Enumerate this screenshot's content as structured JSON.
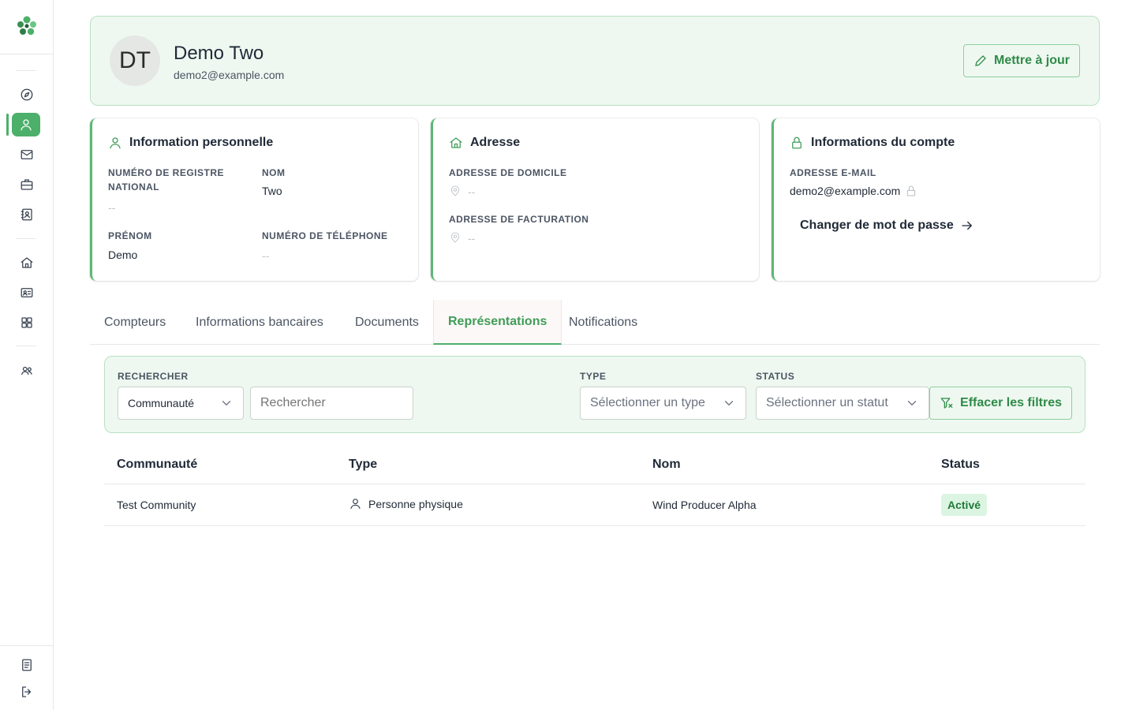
{
  "colors": {
    "accent": "#4caf6a",
    "accent_dark": "#2f8b48",
    "panel_bg": "#eef8f0",
    "badge_bg": "#dcf5e2"
  },
  "sidebar": {
    "icons": [
      "logo-icon",
      "compass-icon",
      "user-icon",
      "mail-icon",
      "briefcase-icon",
      "contacts-icon",
      "home-icon",
      "id-card-icon",
      "grid-icon",
      "users-icon",
      "document-icon",
      "logout-icon"
    ]
  },
  "profile": {
    "initials": "DT",
    "name": "Demo Two",
    "email": "demo2@example.com",
    "update_label": "Mettre à jour"
  },
  "personal": {
    "title": "Information personnelle",
    "registry_label": "NUMÉRO DE REGISTRE NATIONAL",
    "registry_value": "--",
    "lastname_label": "NOM",
    "lastname_value": "Two",
    "firstname_label": "PRÉNOM",
    "firstname_value": "Demo",
    "phone_label": "NUMÉRO DE TÉLÉPHONE",
    "phone_value": "--"
  },
  "address": {
    "title": "Adresse",
    "home_label": "ADRESSE DE DOMICILE",
    "home_value": "--",
    "billing_label": "ADRESSE DE FACTURATION",
    "billing_value": "--"
  },
  "account": {
    "title": "Informations du compte",
    "email_label": "ADRESSE E-MAIL",
    "email_value": "demo2@example.com",
    "password_link": "Changer de mot de passe"
  },
  "tabs": [
    {
      "label": "Compteurs",
      "active": false
    },
    {
      "label": "Informations bancaires",
      "active": false
    },
    {
      "label": "Documents",
      "active": false
    },
    {
      "label": "Représentations",
      "active": true
    },
    {
      "label": "Notifications",
      "active": false
    }
  ],
  "filters": {
    "search_label": "RECHERCHER",
    "search_scope": "Communauté",
    "search_placeholder": "Rechercher",
    "type_label": "TYPE",
    "type_placeholder": "Sélectionner un type",
    "status_label": "STATUS",
    "status_placeholder": "Sélectionner un statut",
    "clear_label": "Effacer les filtres"
  },
  "table": {
    "columns": [
      "Communauté",
      "Type",
      "Nom",
      "Status"
    ],
    "rows": [
      {
        "community": "Test Community",
        "type": "Personne physique",
        "name": "Wind Producer Alpha",
        "status": "Activé"
      }
    ]
  }
}
